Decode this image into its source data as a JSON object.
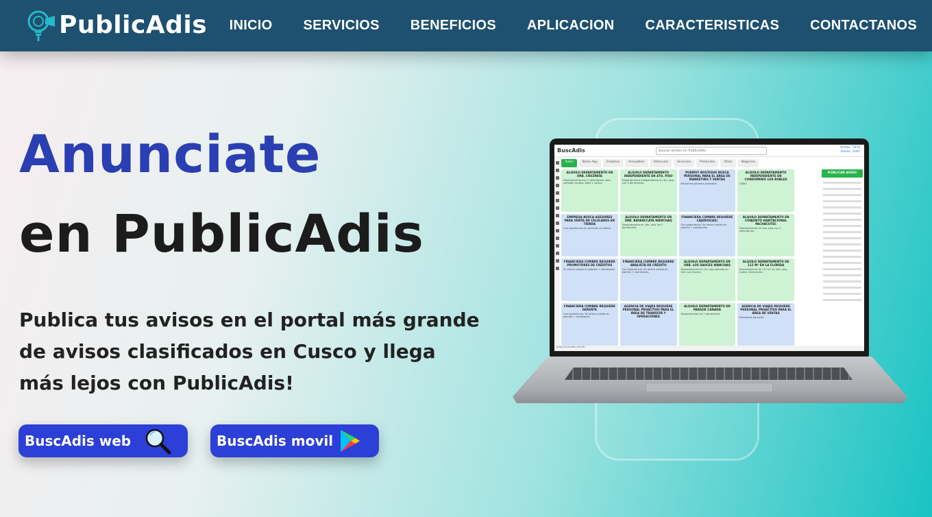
{
  "nav": {
    "brand": "PublicAdis",
    "menu": [
      "INICIO",
      "SERVICIOS",
      "BENEFICIOS",
      "APLICACION",
      "CARACTERISTICAS",
      "CONTACTANOS"
    ]
  },
  "hero": {
    "title_line1": "Anunciate",
    "title_line2": "en PublicAdis",
    "lead_lines": [
      "Publica tus avisos en el portal más grande",
      "de avisos clasificados en Cusco y llega",
      "más lejos con PublicAdis!"
    ],
    "btn_web": "BuscAdis web",
    "btn_movil": "BuscAdis movil",
    "btn_web_icon": "magnifier-icon",
    "btn_movil_icon": "play-store-icon"
  },
  "laptop_screen": {
    "logo": "BuscAdis",
    "search_placeholder": "buscar avisos en PublicAdis",
    "stats": [
      "Visitas: 7876",
      "Avisos: 3187"
    ],
    "tabs": [
      "Todos",
      "Bolsa Aqu",
      "Empleos",
      "Inmuebles",
      "Vehiculos",
      "Servicios",
      "Productos",
      "Otros",
      "Negocios"
    ],
    "publish": "PUBLICAR AVISO",
    "cards": [
      {
        "t": "ALQUILO DEPARTAMENTO EN URB. CRUZPATA",
        "d": "Departamento con 2 dormitorios, sala-comedor amplio, baño y cocina."
      },
      {
        "t": "ALQUILO DEPARTAMENTO INDEPENDIENTE EN 4TO. PISO",
        "d": "Departamento independiente en 4to. piso, con 3 dormitorios."
      },
      {
        "t": "PURMUY BOUTIQUE BUSCA PERSONAL PARA EL ÁREA DE MARKETING Y VENTAS",
        "d": "Buscamos persona proactiva."
      },
      {
        "t": "ALQUILO DEPARTAMENTO INDEPENDIENTE EN CONDOMINIO LOS ROBLES",
        "d": "S/800"
      },
      {
        "t": "EMPRESA BUSCA ASESORES PARA VENTA DE CELULARES EN TIENDA",
        "d": "Con experiencia en atención al cliente."
      },
      {
        "t": "ALQUILO DEPARTAMENTO EN URB. BAYANCCATA WANCHAQ",
        "d": "Departamento en 2do. piso, de 2 dormitorios."
      },
      {
        "t": "FINANCIERA CUMBRE REQUIERE CAJEROS(AS)",
        "d": "Con experiencia. Se ofrece sueldo en planilla + comisiones."
      },
      {
        "t": "ALQUILO DEPARTAMENTO EN CONJUNTO HABITACIONAL PACHACUTEC",
        "d": "Departamento en 2do. piso con 2 dormitorios."
      },
      {
        "t": "FINANCIERA CUMBRE REQUIERE PROMOTORES DE CRÉDITOS",
        "d": "Se ofrece sueldo en planilla + comisiones."
      },
      {
        "t": "FINANCIERA CUMBRE REQUIERE ANALISTA DE CRÉDITO",
        "d": "Con experiencia. Se ofrece sueldo en planilla + comisiones."
      },
      {
        "t": "ALQUILO DEPARTAMENTO EN URB. LOS SAUCES WANCHAQ",
        "d": "Departamento en 1er. piso ubicado en Urb. Los Sauces."
      },
      {
        "t": "ALQUILO DEPARTAMENTO DE 112 M² EN LA FLORIDA",
        "d": "Departamento de 112 m² en 2do. piso, buena iluminación."
      },
      {
        "t": "FINANCIERA CUMBRE REQUIERE GERENTE",
        "d": "Con experiencia. Se ofrece sueldo en planilla + comisiones."
      },
      {
        "t": "AGENCIA DE VIAJES REQUIERE PERSONAL PROACTIVO PARA EL ÁREA DE TRANSFER Y OPERACIONES",
        "d": ""
      },
      {
        "t": "ALQUILO DEPARTAMENTO EN PARQUE CANADÁ",
        "d": "Departamento de 2 dormitorios."
      },
      {
        "t": "AGENCIA DE VIAJES REQUIERE PERSONAL PROACTIVO PARA EL ÁREA DE VENTAS",
        "d": "Buscamos personal."
      }
    ],
    "footer_url": "https://buscadis.com/#/"
  }
}
